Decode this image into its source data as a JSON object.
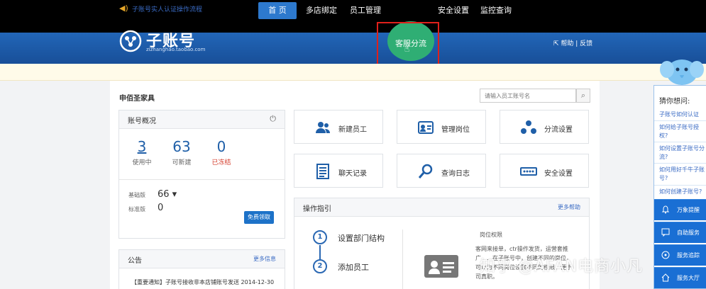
{
  "brand": {
    "title": "子账号",
    "subtitle": "zizhanghao.taobao.com"
  },
  "nav": {
    "items": [
      {
        "label": "首 页",
        "active": true
      },
      {
        "label": "多店绑定"
      },
      {
        "label": "员工管理"
      },
      {
        "label": "客服分流",
        "highlighted": true
      },
      {
        "label": "安全设置"
      },
      {
        "label": "监控查询"
      }
    ],
    "help": "帮助 | 反馈"
  },
  "notice": {
    "text": "子账号实人认证操作流程"
  },
  "store": {
    "name": "申佰圣家具"
  },
  "search": {
    "placeholder": "请输入员工账号名"
  },
  "overview": {
    "title": "账号概况",
    "stats": [
      {
        "value": "3",
        "label": "使用中"
      },
      {
        "value": "63",
        "label": "可新建"
      },
      {
        "value": "0",
        "label": "已冻结"
      }
    ],
    "editions": [
      {
        "label": "基础版",
        "value": "66 ▾"
      },
      {
        "label": "标准版",
        "value": "0"
      }
    ],
    "free_button": "免费领取"
  },
  "announcements": {
    "title": "公告",
    "more": "更多信息",
    "items": [
      {
        "text": "【重要通知】子账号接收非本店铺账号发送",
        "date": "2014-12-30"
      }
    ]
  },
  "tiles": [
    {
      "label": "新建员工",
      "icon": "users-icon"
    },
    {
      "label": "管理岗位",
      "icon": "id-card-icon"
    },
    {
      "label": "分流设置",
      "icon": "network-icon"
    },
    {
      "label": "聊天记录",
      "icon": "document-icon"
    },
    {
      "label": "查询日志",
      "icon": "magnifier-icon"
    },
    {
      "label": "安全设置",
      "icon": "password-icon"
    }
  ],
  "guide": {
    "title": "操作指引",
    "more": "更多帮助",
    "steps": [
      {
        "num": "1",
        "label": "设置部门结构"
      },
      {
        "num": "2",
        "label": "添加员工"
      }
    ],
    "role_title": "岗位权限",
    "role_desc": [
      "客网来接单，ctr操作发货，运营套推",
      "广，…在子账号中，创建不同的岗位，",
      "可以为不同岗位设置不同的权限，便于",
      "司真职。"
    ]
  },
  "watermark": "知乎 @AFAN电商小凡",
  "sidebar": {
    "title": "猜你想问:",
    "questions": [
      "子账号如何认证",
      "如何给子账号授权?",
      "如何设置子账号分流?",
      "如何用好千牛子账号?",
      "如何创建子账号?"
    ],
    "buttons": [
      {
        "label": "万象提醒",
        "icon": "bell-icon"
      },
      {
        "label": "自助服务",
        "icon": "chat-icon"
      },
      {
        "label": "服务追踪",
        "icon": "tracking-icon"
      },
      {
        "label": "服务大厅",
        "icon": "home-icon"
      }
    ]
  },
  "colors": {
    "header": "#1f5eaa",
    "highlight_green": "#2fae74",
    "annotation_red": "#e0201b",
    "sidebar_blue": "#1a6fd4"
  }
}
